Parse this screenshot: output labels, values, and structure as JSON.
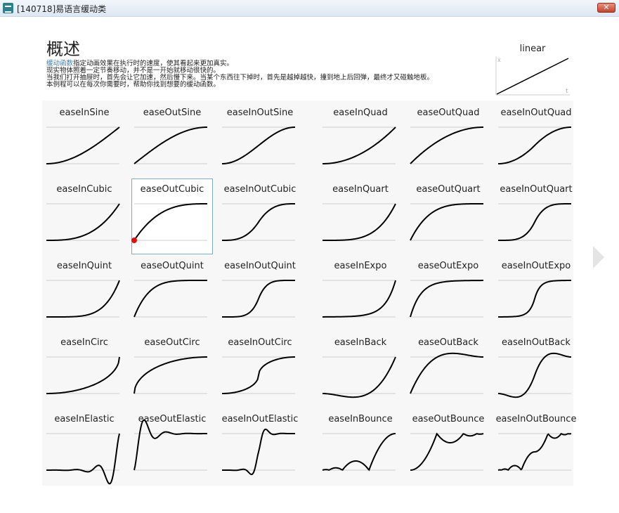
{
  "window": {
    "title": "[140718]易语言缓动类",
    "close_label": "✕"
  },
  "header": {
    "title": "概述",
    "desc_link": "缓动函数",
    "desc_line1": "指定动画效果在执行时的速度，使其看起来更加真实。",
    "desc_line2": "现实物体照着一定节奏移动，并不是一开始就移动很快的。",
    "desc_line3": "当我们打开抽屉时，首先会让它加速，然后慢下来。当某个东西往下掉时，首先是越掉越快，撞到地上后回弹，最终才又碰触地板。",
    "desc_line4": "本例程可以在每次你需要时，帮助你找到想要的缓动函数。"
  },
  "linear_preview": {
    "label": "linear",
    "x_axis": "t",
    "y_axis": "x"
  },
  "easings": [
    [
      "easeInSine",
      "easeOutSine",
      "easeInOutSine",
      "easeInQuad",
      "easeOutQuad",
      "easeInOutQuad"
    ],
    [
      "easeInCubic",
      "easeOutCubic",
      "easeInOutCubic",
      "easeInQuart",
      "easeOutQuart",
      "easeInOutQuart"
    ],
    [
      "easeInQuint",
      "easeOutQuint",
      "easeInOutQuint",
      "easeInExpo",
      "easeOutExpo",
      "easeInOutExpo"
    ],
    [
      "easeInCirc",
      "easeOutCirc",
      "easeInOutCirc",
      "easeInBack",
      "easeOutBack",
      "easeInOutBack"
    ],
    [
      "easeInElastic",
      "easeOutElastic",
      "easeInOutElastic",
      "easeInBounce",
      "easeOutBounce",
      "easeInOutBounce"
    ]
  ],
  "selected": "easeOutCubic",
  "colors": {
    "curve": "#000000",
    "baseline": "#cccccc",
    "selected_border": "#7aaecf",
    "marker": "#e01010",
    "link": "#3a7fb0"
  },
  "icons": {
    "next": "chevron-right-icon",
    "app": "app-icon",
    "close": "close-icon"
  }
}
